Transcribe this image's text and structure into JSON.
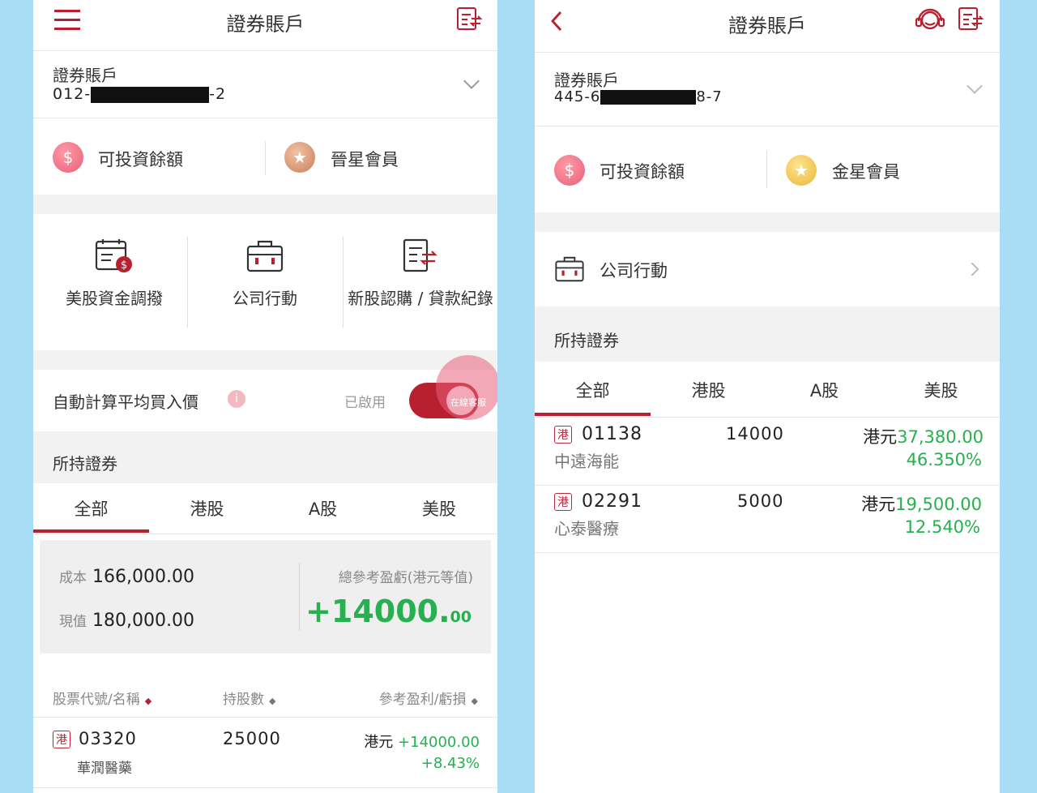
{
  "colors": {
    "accent": "#b8202f",
    "gain": "#27b04f",
    "page_bg": "#a9dcf5"
  },
  "left": {
    "header": {
      "title": "證券賬戶",
      "menu_icon": "hamburger-menu-icon",
      "record_icon": "record-icon"
    },
    "account": {
      "label": "證券賬戶",
      "number_prefix": "012-",
      "number_suffix": "-2"
    },
    "badges": {
      "balance_label": "可投資餘額",
      "member_label": "晉星會員"
    },
    "quick_actions": [
      {
        "label": "美股資金調撥",
        "icon": "us-fund-transfer-icon"
      },
      {
        "label": "公司行動",
        "icon": "briefcase-icon"
      },
      {
        "label": "新股認購 / 貸款紀錄",
        "icon": "ipo-record-icon"
      }
    ],
    "auto_avg": {
      "label": "自動計算平均買入價",
      "status": "已啟用"
    },
    "fab_label": "在線客服",
    "holdings_title": "所持證券",
    "tabs": [
      "全部",
      "港股",
      "A股",
      "美股"
    ],
    "summary": {
      "cost_label": "成本",
      "cost_value": "166,000.00",
      "value_label": "現值",
      "value_value": "180,000.00",
      "pl_label": "總參考盈虧(港元等值)",
      "pl_main": "+14000.",
      "pl_decimal": "00"
    },
    "columns": [
      "股票代號/名稱",
      "持股數",
      "參考盈利/虧損"
    ],
    "holdings": [
      {
        "market": "港",
        "code": "03320",
        "name": "華潤醫藥",
        "shares": "25000",
        "currency": "港元",
        "pl": "+14000.00",
        "pct": "+8.43%"
      }
    ]
  },
  "right": {
    "header": {
      "title": "證券賬戶",
      "back_icon": "back-arrow-icon",
      "support_icon": "customer-service-icon",
      "record_icon": "record-icon"
    },
    "account": {
      "label": "證券賬戶",
      "number_prefix": "445-6",
      "number_suffix": "8-7"
    },
    "badges": {
      "balance_label": "可投資餘額",
      "member_label": "金星會員"
    },
    "corporate_action": "公司行動",
    "holdings_title": "所持證券",
    "tabs": [
      "全部",
      "港股",
      "A股",
      "美股"
    ],
    "holdings": [
      {
        "market": "港",
        "code": "01138",
        "name": "中遠海能",
        "shares": "14000",
        "currency": "港元",
        "value": "37,380.00",
        "pct": "46.350%"
      },
      {
        "market": "港",
        "code": "02291",
        "name": "心泰醫療",
        "shares": "5000",
        "currency": "港元",
        "value": "19,500.00",
        "pct": "12.540%"
      }
    ]
  }
}
